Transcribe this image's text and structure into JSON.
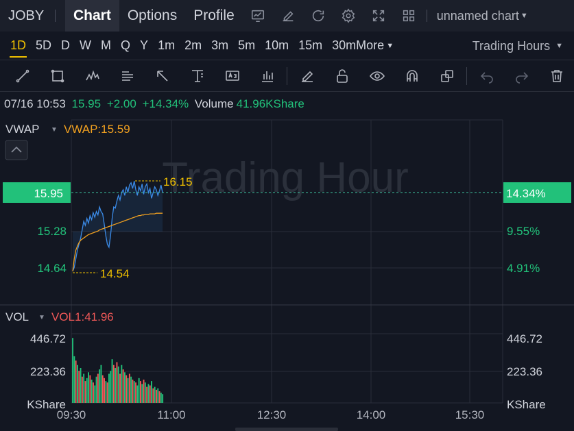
{
  "header": {
    "ticker": "JOBY",
    "tabs": [
      "Chart",
      "Options",
      "Profile"
    ],
    "chart_name": "unnamed chart"
  },
  "intervals": [
    "1D",
    "5D",
    "D",
    "W",
    "M",
    "Q",
    "Y",
    "1m",
    "2m",
    "3m",
    "5m",
    "10m",
    "15m",
    "30m"
  ],
  "more_label": "More",
  "trading_hours_label": "Trading Hours",
  "info": {
    "datetime": "07/16 10:53",
    "price": "15.95",
    "change": "+2.00",
    "change_pct": "+14.34%",
    "volume_label": "Volume",
    "volume_value": "41.96KShare"
  },
  "colors": {
    "up": "#22c17a",
    "down": "#f05858",
    "price_line": "#3b8be8",
    "vwap": "#f0a020",
    "accent": "#f0c000"
  },
  "main_pane": {
    "indicator": "VWAP",
    "indicator_value": "VWAP:15.59",
    "watermark": "Trading Hour",
    "current_price": "15.95",
    "current_pct": "14.34%",
    "left_ticks": [
      "15.28",
      "14.64"
    ],
    "right_ticks": [
      "9.55%",
      "4.91%"
    ],
    "high_label": "16.15",
    "low_label": "14.54"
  },
  "vol_pane": {
    "indicator": "VOL",
    "indicator_value": "VOL1:41.96",
    "ticks": [
      "446.72",
      "223.36"
    ],
    "unit": "KShare"
  },
  "x_ticks": [
    "09:30",
    "11:00",
    "12:30",
    "14:00",
    "15:30"
  ],
  "chart_data": {
    "type": "line",
    "x_range": [
      "09:30",
      "16:00"
    ],
    "price_range": [
      14.0,
      16.6
    ],
    "price": [
      14.58,
      14.65,
      14.8,
      14.95,
      15.05,
      15.15,
      15.3,
      15.45,
      15.38,
      15.5,
      15.42,
      15.55,
      15.48,
      15.6,
      15.52,
      15.62,
      15.56,
      15.7,
      15.62,
      15.58,
      15.4,
      15.2,
      15.05,
      15.0,
      15.2,
      15.5,
      15.7,
      15.68,
      15.8,
      15.9,
      15.82,
      15.95,
      16.0,
      15.9,
      16.05,
      15.95,
      16.08,
      16.12,
      16.02,
      16.15,
      16.0,
      15.9,
      16.05,
      15.98,
      16.1,
      15.92,
      16.05,
      16.1,
      15.95,
      16.02,
      15.85,
      15.95,
      16.05,
      16.0,
      15.9,
      15.98,
      16.08,
      15.95
    ],
    "vwap": [
      14.58,
      14.8,
      14.95,
      15.02,
      15.08,
      15.12,
      15.14,
      15.16,
      15.18,
      15.2,
      15.22,
      15.23,
      15.24,
      15.25,
      15.26,
      15.27,
      15.28,
      15.3,
      15.31,
      15.32,
      15.33,
      15.34,
      15.35,
      15.36,
      15.37,
      15.38,
      15.39,
      15.4,
      15.41,
      15.42,
      15.43,
      15.44,
      15.45,
      15.46,
      15.47,
      15.48,
      15.49,
      15.5,
      15.51,
      15.52,
      15.53,
      15.54,
      15.55,
      15.55,
      15.56,
      15.56,
      15.57,
      15.57,
      15.57,
      15.58,
      15.58,
      15.58,
      15.58,
      15.59,
      15.59,
      15.59,
      15.59,
      15.59
    ],
    "volume": [
      446,
      320,
      290,
      260,
      220,
      240,
      180,
      200,
      150,
      170,
      210,
      190,
      160,
      140,
      120,
      180,
      200,
      230,
      260,
      190,
      170,
      150,
      140,
      200,
      220,
      300,
      260,
      240,
      280,
      250,
      200,
      260,
      230,
      210,
      190,
      170,
      200,
      180,
      160,
      150,
      140,
      120,
      170,
      150,
      130,
      160,
      140,
      110,
      130,
      120,
      150,
      100,
      110,
      90,
      100,
      80,
      70,
      60
    ],
    "volume_up": [
      true,
      true,
      false,
      true,
      false,
      true,
      false,
      true,
      false,
      true,
      true,
      false,
      true,
      false,
      true,
      true,
      false,
      true,
      true,
      false,
      false,
      true,
      false,
      true,
      true,
      true,
      false,
      true,
      false,
      true,
      false,
      true,
      false,
      true,
      false,
      true,
      false,
      true,
      false,
      true,
      false,
      true,
      true,
      false,
      true,
      false,
      true,
      false,
      true,
      false,
      true,
      false,
      true,
      false,
      true,
      false,
      true,
      true
    ],
    "volume_range": [
      0,
      446.72
    ]
  }
}
